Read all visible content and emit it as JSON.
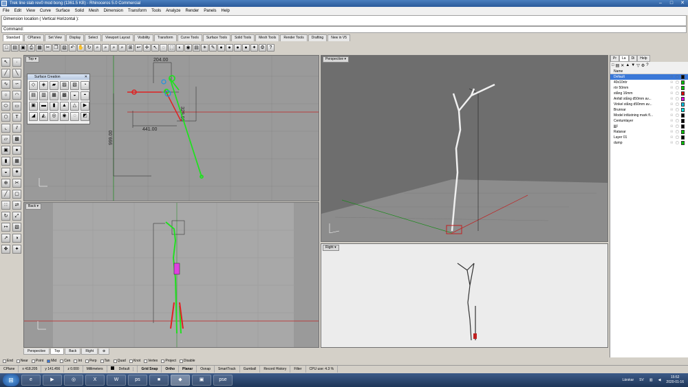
{
  "window": {
    "title": "Trek line slab rev0 mod bong (1361.5 KB) - Rhinoceros 5.0 Commercial"
  },
  "menu": [
    "File",
    "Edit",
    "View",
    "Curve",
    "Surface",
    "Solid",
    "Mesh",
    "Dimension",
    "Transform",
    "Tools",
    "Analyze",
    "Render",
    "Panels",
    "Help"
  ],
  "command": {
    "history": "Dimension location ( Vertical  Horizontal ):",
    "prompt": "Command:"
  },
  "toolbar_tabs": [
    "Standard",
    "CPlanes",
    "Set View",
    "Display",
    "Select",
    "Viewport Layout",
    "Visibility",
    "Transform",
    "Curve Tools",
    "Surface Tools",
    "Solid Tools",
    "Mesh Tools",
    "Render Tools",
    "Drafting",
    "New in V5"
  ],
  "toolbar_tabs_active": 0,
  "surface_creation": {
    "title": "Surface Creation"
  },
  "viewports": {
    "top": {
      "label": "Top",
      "dim_top": "204.00",
      "dim_right": "329.00",
      "dim_mid": "441.00",
      "dim_left": "999.00"
    },
    "perspective": {
      "label": "Perspective"
    },
    "back": {
      "label": "Back"
    },
    "right": {
      "label": "Right"
    }
  },
  "viewport_tabs": [
    "Perspective",
    "Top",
    "Back",
    "Right",
    "⊕"
  ],
  "viewport_tabs_active": 1,
  "panel_tabs": [
    "Pr",
    "La",
    "Di",
    "Help"
  ],
  "panel_tabs_active": 1,
  "layers_header": "Name",
  "layers": [
    {
      "name": "Default",
      "color": "#000000",
      "selected": true
    },
    {
      "name": "40x10rör",
      "color": "#00c000"
    },
    {
      "name": "rör 50mm",
      "color": "#00c000"
    },
    {
      "name": "stång 16mm",
      "color": "#e00000"
    },
    {
      "name": "Anfall stång d50mm av...",
      "color": "#e000e0"
    },
    {
      "name": "Vinkel stång d50mm av...",
      "color": "#00c0e0"
    },
    {
      "name": "Brunnar",
      "color": "#00e0e0"
    },
    {
      "name": "Model infästning mark fl...",
      "color": "#000000"
    },
    {
      "name": "Centumlayer",
      "color": "#000000"
    },
    {
      "name": "jjjjl",
      "color": "#000000"
    },
    {
      "name": "Ratanar",
      "color": "#00c000"
    },
    {
      "name": "Layer 01",
      "color": "#000000"
    },
    {
      "name": "dump",
      "color": "#00c000"
    }
  ],
  "osnaps": [
    {
      "label": "End",
      "on": false
    },
    {
      "label": "Near",
      "on": false
    },
    {
      "label": "Point",
      "on": false
    },
    {
      "label": "Mid",
      "on": true
    },
    {
      "label": "Cen",
      "on": false
    },
    {
      "label": "Int",
      "on": false
    },
    {
      "label": "Perp",
      "on": false
    },
    {
      "label": "Tan",
      "on": false
    },
    {
      "label": "Quad",
      "on": false
    },
    {
      "label": "Knot",
      "on": false
    },
    {
      "label": "Vertex",
      "on": false
    },
    {
      "label": "Project",
      "on": false
    },
    {
      "label": "Disable",
      "on": false
    }
  ],
  "status": {
    "cplane": "CPlane",
    "x": "x 418.205",
    "y": "y 141.456",
    "z": "z 0.000",
    "units": "Millimeters",
    "layer": "Default",
    "grid_snap": "Grid Snap",
    "ortho": "Ortho",
    "planar": "Planar",
    "osnap": "Osnap",
    "smarttrack": "SmartTrack",
    "gumball": "Gumball",
    "record_history": "Record History",
    "filter": "Filter",
    "cpu": "CPU use: 4.3 %"
  },
  "taskbar": {
    "apps": [
      "e",
      "▶",
      "◎",
      "X",
      "W",
      "ps",
      "■",
      "◆",
      "▣",
      "pse"
    ],
    "lang": "SV",
    "tray_user": "Lärskar",
    "time": "15:52",
    "date": "2020-01-16"
  }
}
